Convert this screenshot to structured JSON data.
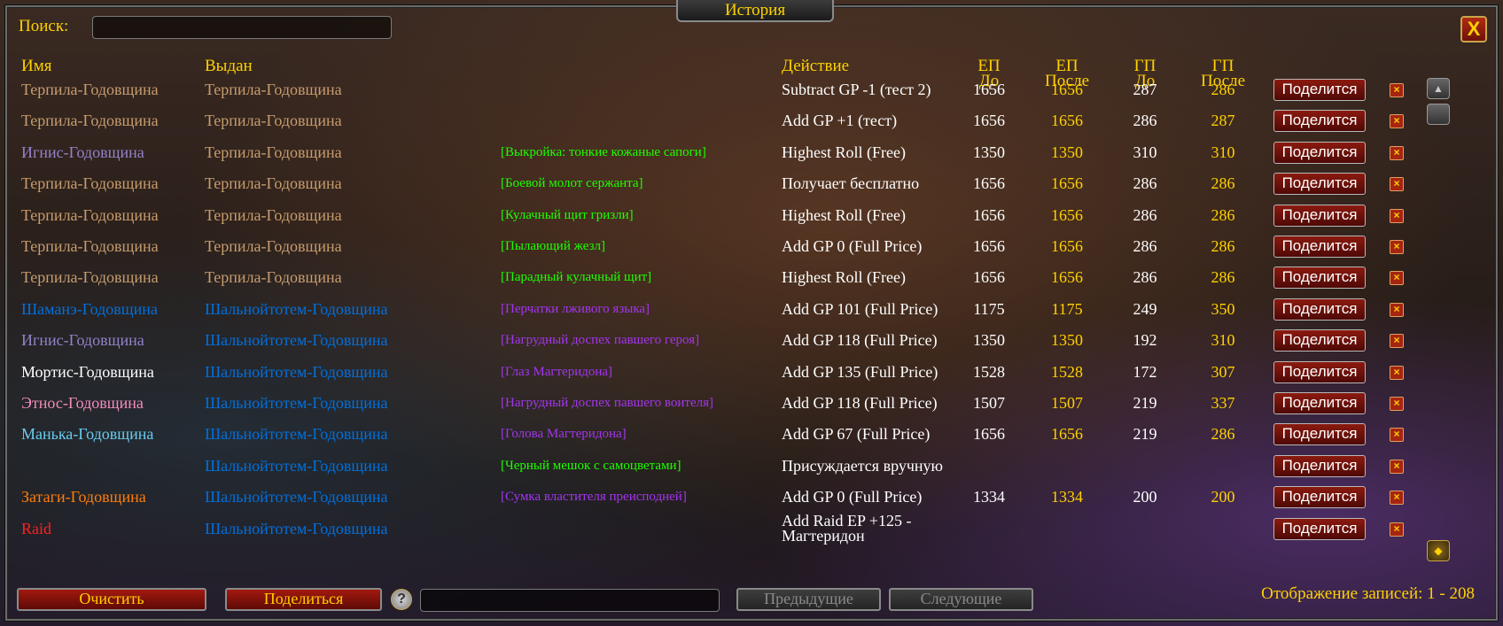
{
  "window": {
    "title": "История",
    "close_label": "X"
  },
  "search": {
    "label": "Поиск:",
    "value": ""
  },
  "headers": {
    "name": "Имя",
    "given": "Выдан",
    "action": "Действие",
    "ep_before": [
      "ЕП",
      "До"
    ],
    "ep_after": [
      "ЕП",
      "После"
    ],
    "gp_before": [
      "ГП",
      "До"
    ],
    "gp_after": [
      "ГП",
      "После"
    ]
  },
  "colors": {
    "gold": "#ffd100",
    "paladin": "#f58cba",
    "warrior": "#c79c6e",
    "mage": "#69ccf0",
    "warlock": "#9482c9",
    "shaman": "#0070de",
    "druid": "#ff7d0a",
    "priest": "#ffffff",
    "raid": "#ff2020",
    "uncommon": "#1eff00",
    "epic": "#a335ee"
  },
  "row_share_label": "Поделится",
  "row_delete_label": "×",
  "rows": [
    {
      "name": "Терпила-Годовщина",
      "name_color": "#c79c6e",
      "given": "Терпила-Годовщина",
      "given_color": "#c79c6e",
      "item": "",
      "item_color": "#1eff00",
      "action": "Subtract GP -1 (тест 2)",
      "ep_before": "1656",
      "ep_after": "1656",
      "gp_before": "287",
      "gp_after": "286"
    },
    {
      "name": "Терпила-Годовщина",
      "name_color": "#c79c6e",
      "given": "Терпила-Годовщина",
      "given_color": "#c79c6e",
      "item": "",
      "item_color": "#1eff00",
      "action": "Add GP +1 (тест)",
      "ep_before": "1656",
      "ep_after": "1656",
      "gp_before": "286",
      "gp_after": "287"
    },
    {
      "name": "Игнис-Годовщина",
      "name_color": "#9482c9",
      "given": "Терпила-Годовщина",
      "given_color": "#c79c6e",
      "item": "[Выкройка: тонкие кожаные сапоги]",
      "item_color": "#1eff00",
      "action": "Highest Roll (Free)",
      "ep_before": "1350",
      "ep_after": "1350",
      "gp_before": "310",
      "gp_after": "310"
    },
    {
      "name": "Терпила-Годовщина",
      "name_color": "#c79c6e",
      "given": "Терпила-Годовщина",
      "given_color": "#c79c6e",
      "item": "[Боевой молот сержанта]",
      "item_color": "#1eff00",
      "action": "Получает бесплатно",
      "ep_before": "1656",
      "ep_after": "1656",
      "gp_before": "286",
      "gp_after": "286"
    },
    {
      "name": "Терпила-Годовщина",
      "name_color": "#c79c6e",
      "given": "Терпила-Годовщина",
      "given_color": "#c79c6e",
      "item": "[Кулачный щит гризли]",
      "item_color": "#1eff00",
      "action": "Highest Roll (Free)",
      "ep_before": "1656",
      "ep_after": "1656",
      "gp_before": "286",
      "gp_after": "286"
    },
    {
      "name": "Терпила-Годовщина",
      "name_color": "#c79c6e",
      "given": "Терпила-Годовщина",
      "given_color": "#c79c6e",
      "item": "[Пылающий жезл]",
      "item_color": "#1eff00",
      "action": "Add GP 0 (Full Price)",
      "ep_before": "1656",
      "ep_after": "1656",
      "gp_before": "286",
      "gp_after": "286"
    },
    {
      "name": "Терпила-Годовщина",
      "name_color": "#c79c6e",
      "given": "Терпила-Годовщина",
      "given_color": "#c79c6e",
      "item": "[Парадный кулачный щит]",
      "item_color": "#1eff00",
      "action": "Highest Roll (Free)",
      "ep_before": "1656",
      "ep_after": "1656",
      "gp_before": "286",
      "gp_after": "286"
    },
    {
      "name": "Шаманэ-Годовщина",
      "name_color": "#0070de",
      "given": "Шальнойтотем-Годовщина",
      "given_color": "#0070de",
      "item": "[Перчатки лживого языка]",
      "item_color": "#a335ee",
      "action": "Add GP 101 (Full Price)",
      "ep_before": "1175",
      "ep_after": "1175",
      "gp_before": "249",
      "gp_after": "350"
    },
    {
      "name": "Игнис-Годовщина",
      "name_color": "#9482c9",
      "given": "Шальнойтотем-Годовщина",
      "given_color": "#0070de",
      "item": "[Нагрудный доспех павшего героя]",
      "item_color": "#a335ee",
      "action": "Add GP 118 (Full Price)",
      "ep_before": "1350",
      "ep_after": "1350",
      "gp_before": "192",
      "gp_after": "310"
    },
    {
      "name": "Мортис-Годовщина",
      "name_color": "#ffffff",
      "given": "Шальнойтотем-Годовщина",
      "given_color": "#0070de",
      "item": "[Глаз Магтеридона]",
      "item_color": "#a335ee",
      "action": "Add GP 135 (Full Price)",
      "ep_before": "1528",
      "ep_after": "1528",
      "gp_before": "172",
      "gp_after": "307"
    },
    {
      "name": "Этнос-Годовщина",
      "name_color": "#f58cba",
      "given": "Шальнойтотем-Годовщина",
      "given_color": "#0070de",
      "item": "[Нагрудный доспех павшего воителя]",
      "item_color": "#a335ee",
      "action": "Add GP 118 (Full Price)",
      "ep_before": "1507",
      "ep_after": "1507",
      "gp_before": "219",
      "gp_after": "337"
    },
    {
      "name": "Манька-Годовщина",
      "name_color": "#69ccf0",
      "given": "Шальнойтотем-Годовщина",
      "given_color": "#0070de",
      "item": "[Голова Магтеридона]",
      "item_color": "#a335ee",
      "action": "Add GP 67 (Full Price)",
      "ep_before": "1656",
      "ep_after": "1656",
      "gp_before": "219",
      "gp_after": "286"
    },
    {
      "name": "",
      "name_color": "#ffffff",
      "given": "Шальнойтотем-Годовщина",
      "given_color": "#0070de",
      "item": "[Черный мешок с самоцветами]",
      "item_color": "#1eff00",
      "action": "Присуждается вручную",
      "ep_before": "",
      "ep_after": "",
      "gp_before": "",
      "gp_after": ""
    },
    {
      "name": "Затаги-Годовщина",
      "name_color": "#ff7d0a",
      "given": "Шальнойтотем-Годовщина",
      "given_color": "#0070de",
      "item": "[Сумка властителя преисподней]",
      "item_color": "#a335ee",
      "action": "Add GP 0 (Full Price)",
      "ep_before": "1334",
      "ep_after": "1334",
      "gp_before": "200",
      "gp_after": "200"
    },
    {
      "name": "Raid",
      "name_color": "#ff2020",
      "given": "Шальнойтотем-Годовщина",
      "given_color": "#0070de",
      "item": "",
      "item_color": "#1eff00",
      "action": "Add Raid EP +125 - Магтеридон",
      "ep_before": "",
      "ep_after": "",
      "gp_before": "",
      "gp_after": ""
    }
  ],
  "footer": {
    "clear_label": "Очистить",
    "share_label": "Поделиться",
    "help_label": "?",
    "input_value": "",
    "prev_label": "Предыдущие",
    "next_label": "Следующие",
    "status_text": "Отображение записей: 1 - 208"
  },
  "icons": [
    "close-icon",
    "help-icon",
    "scroll-up-icon",
    "scroll-down-icon",
    "crest-icon",
    "delete-icon"
  ]
}
